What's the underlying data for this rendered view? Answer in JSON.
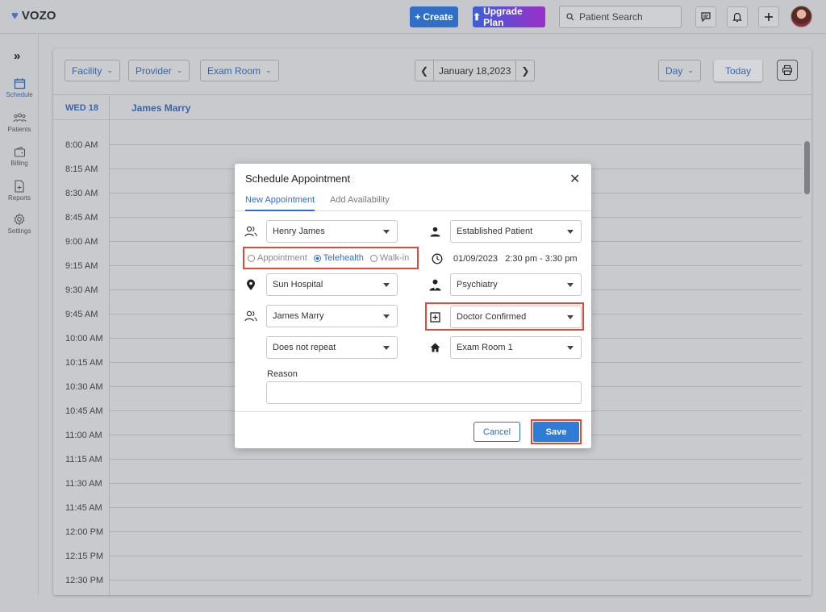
{
  "app": {
    "logo": "VOZO"
  },
  "topbar": {
    "create_label": "Create",
    "upgrade_label": "Upgrade Plan",
    "search_placeholder": "Patient Search"
  },
  "sidebar": {
    "items": [
      {
        "label": "Schedule",
        "icon": "calendar-icon",
        "active": true
      },
      {
        "label": "Patients",
        "icon": "patients-icon",
        "active": false
      },
      {
        "label": "Billing",
        "icon": "wallet-icon",
        "active": false
      },
      {
        "label": "Reports",
        "icon": "report-icon",
        "active": false
      },
      {
        "label": "Settings",
        "icon": "gear-icon",
        "active": false
      }
    ]
  },
  "filters": {
    "facility": "Facility",
    "provider": "Provider",
    "exam_room": "Exam Room",
    "date": "January 18,2023",
    "view": "Day",
    "today": "Today"
  },
  "calendar": {
    "day_header": "WED 18",
    "provider_header": "James Marry",
    "times": [
      "8:00 AM",
      "8:15 AM",
      "8:30 AM",
      "8:45 AM",
      "9:00 AM",
      "9:15 AM",
      "9:30 AM",
      "9:45 AM",
      "10:00 AM",
      "10:15 AM",
      "10:30 AM",
      "10:45 AM",
      "11:00 AM",
      "11:15 AM",
      "11:30 AM",
      "11:45 AM",
      "12:00 PM",
      "12:15 PM",
      "12:30 PM"
    ]
  },
  "modal": {
    "title": "Schedule Appointment",
    "tabs": {
      "new": "New Appointment",
      "availability": "Add Availability"
    },
    "patient": "Henry James",
    "visit_types": {
      "appointment": "Appointment",
      "telehealth": "Telehealth",
      "walkin": "Walk-in",
      "selected": "Telehealth"
    },
    "facility": "Sun Hospital",
    "provider": "James Marry",
    "repeat": "Does not repeat",
    "patient_type": "Established Patient",
    "date": "01/09/2023",
    "time": "2:30 pm - 3:30 pm",
    "specialty": "Psychiatry",
    "status": "Doctor Confirmed",
    "room": "Exam Room 1",
    "reason_label": "Reason",
    "reason_value": "",
    "cancel_label": "Cancel",
    "save_label": "Save"
  },
  "colors": {
    "accent": "#2f6fc8",
    "highlight": "#e04a3b"
  }
}
